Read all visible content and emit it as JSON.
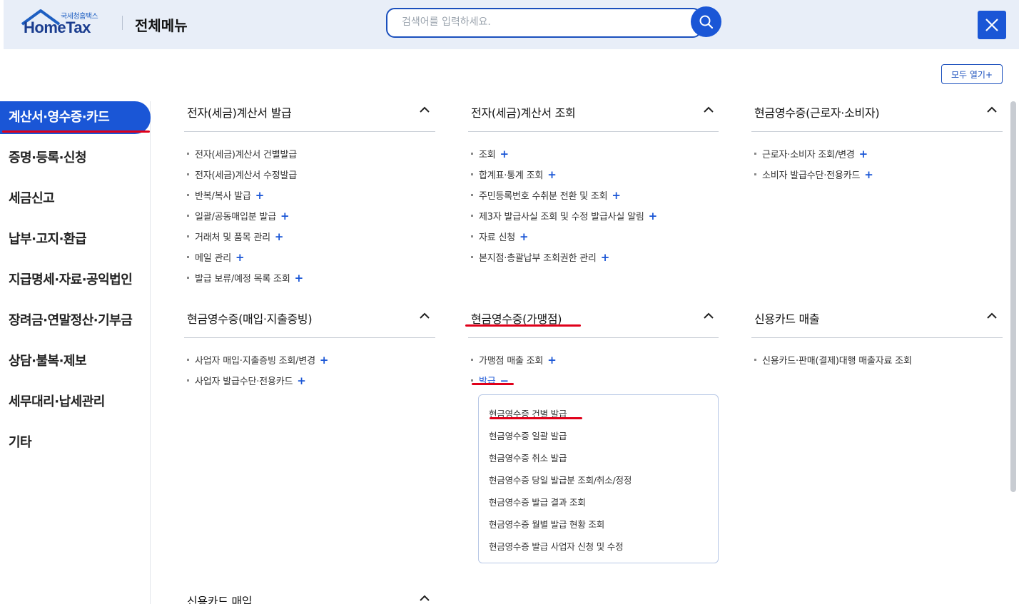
{
  "header": {
    "logo_small": "국세청홈택스",
    "logo_big": "HomeTax",
    "title": "전체메뉴",
    "search_placeholder": "검색어를 입력하세요.",
    "accent_color": "#1a56d6"
  },
  "toolbar": {
    "open_all_label": "모두 열기+"
  },
  "sidebar": {
    "items": [
      {
        "label": "계산서·영수증·카드",
        "active": true
      },
      {
        "label": "증명·등록·신청"
      },
      {
        "label": "세금신고"
      },
      {
        "label": "납부·고지·환급"
      },
      {
        "label": "지급명세·자료·공익법인"
      },
      {
        "label": "장려금·연말정산·기부금"
      },
      {
        "label": "상담·불복·제보"
      },
      {
        "label": "세무대리·납세관리"
      },
      {
        "label": "기타"
      }
    ]
  },
  "sections": {
    "s1": {
      "title": "전자(세금)계산서 발급",
      "items": [
        "전자(세금)계산서 건별발급",
        "전자(세금)계산서 수정발급",
        "반복/복사 발급",
        "일괄/공동매입분 발급",
        "거래처 및 품목 관리",
        "메일 관리",
        "발급 보류/예정 목록 조회"
      ]
    },
    "s2": {
      "title": "전자(세금)계산서 조회",
      "items": [
        "조회",
        "합계표·통계 조회",
        "주민등록번호 수취분 전환 및 조회",
        "제3자 발급사실 조회 및 수정 발급사실 알림",
        "자료 신청",
        "본지점·총괄납부 조회권한 관리"
      ]
    },
    "s3": {
      "title": "현금영수증(근로자·소비자)",
      "items": [
        "근로자·소비자 조회/변경",
        "소비자 발급수단·전용카드"
      ]
    },
    "s4": {
      "title": "현금영수증(매입·지출증빙)",
      "items": [
        "사업자 매입·지출증빙 조회/변경",
        "사업자 발급수단·전용카드"
      ]
    },
    "s5": {
      "title": "현금영수증(가맹점)",
      "items": [
        "가맹점 매출 조회",
        "발급"
      ],
      "sub_items": [
        "현금영수증 건별 발급",
        "현금영수증 일괄 발급",
        "현금영수증 취소 발급",
        "현금영수증 당일 발급분 조회/취소/정정",
        "현금영수증 발급 결과 조회",
        "현금영수증 월별 발급 현황 조회",
        "현금영수증 발급 사업자 신청 및 수정"
      ]
    },
    "s6": {
      "title": "신용카드 매출",
      "items": [
        "신용카드·판매(결제)대행 매출자료 조회"
      ]
    },
    "s7": {
      "title": "신용카드 매입"
    }
  }
}
